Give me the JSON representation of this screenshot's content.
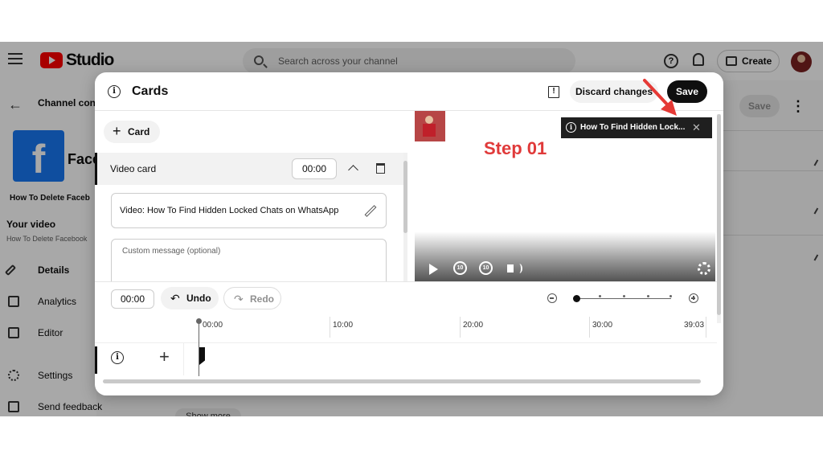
{
  "studio": {
    "logo_text": "Studio",
    "search_placeholder": "Search across your channel",
    "help_glyph": "?",
    "create_label": "Create"
  },
  "sidebar": {
    "back_arrow": "←",
    "channel_content": "Channel cont",
    "thumb_letter": "f",
    "channel_name": "Face",
    "video_title": "How To Delete Faceb",
    "your_video_label": "Your video",
    "your_video_sub": "How To Delete Facebook",
    "items": [
      {
        "label": "Details"
      },
      {
        "label": "Analytics"
      },
      {
        "label": "Editor"
      },
      {
        "label": "Settings"
      },
      {
        "label": "Send feedback"
      }
    ]
  },
  "background_main": {
    "save_label": "Save",
    "more_glyph": "⋮",
    "show_more_label": "Show more"
  },
  "dialog": {
    "info_glyph": "i",
    "title": "Cards",
    "feedback_glyph": "!",
    "discard_label": "Discard changes",
    "save_label": "Save",
    "add_card_plus": "+",
    "add_card_label": "Card",
    "card": {
      "type_label": "Video card",
      "time": "00:00",
      "video_field": "Video: How To Find Hidden Locked Chats on WhatsApp",
      "custom_message_placeholder": "Custom message (optional)"
    },
    "preview": {
      "teaser_text": "How To Find Hidden Lock...",
      "teaser_close": "✕",
      "step_label": "Step 01",
      "rewind_seconds": "10",
      "forward_seconds": "10"
    },
    "toolbar": {
      "current_time": "00:00",
      "undo_arrow": "↶",
      "undo_label": "Undo",
      "redo_arrow": "↷",
      "redo_label": "Redo"
    },
    "timeline": {
      "ticks": [
        "00:00",
        "10:00",
        "20:00",
        "30:00",
        "39:03"
      ],
      "add_plus": "+"
    }
  },
  "colors": {
    "accent_red": "#e03a3a",
    "save_bg": "#0f0f0f",
    "youtube_red": "#ff0000",
    "facebook_blue": "#1877f2"
  }
}
